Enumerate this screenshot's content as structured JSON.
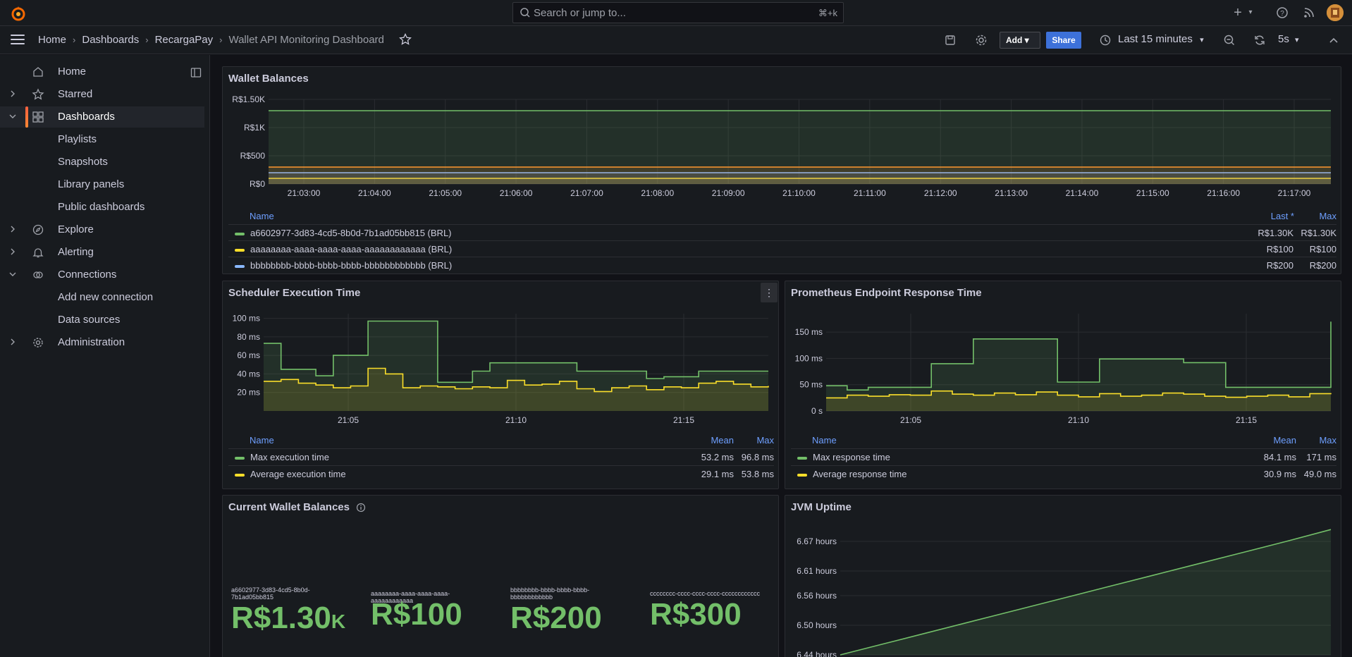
{
  "search": {
    "placeholder": "Search or jump to...",
    "shortcut": "⌘+k"
  },
  "breadcrumb": [
    "Home",
    "Dashboards",
    "RecargaPay",
    "Wallet API Monitoring Dashboard"
  ],
  "toolbar": {
    "add_label": "Add",
    "share_label": "Share",
    "time_range": "Last 15 minutes",
    "refresh_interval": "5s"
  },
  "sidebar": {
    "items": [
      {
        "label": "Home"
      },
      {
        "label": "Starred"
      },
      {
        "label": "Dashboards"
      },
      {
        "label": "Playlists"
      },
      {
        "label": "Snapshots"
      },
      {
        "label": "Library panels"
      },
      {
        "label": "Public dashboards"
      },
      {
        "label": "Explore"
      },
      {
        "label": "Alerting"
      },
      {
        "label": "Connections"
      },
      {
        "label": "Add new connection"
      },
      {
        "label": "Data sources"
      },
      {
        "label": "Administration"
      }
    ]
  },
  "colors": {
    "green": "#73bf69",
    "yellow": "#fade2a",
    "blue": "#8ab8ff",
    "orange": "#ff9830",
    "accent": "#3d71d9"
  },
  "panels": {
    "wallet_balances": {
      "title": "Wallet Balances",
      "legend_headers": {
        "name": "Name",
        "last": "Last *",
        "max": "Max"
      },
      "legend": [
        {
          "name": "a6602977-3d83-4cd5-8b0d-7b1ad05bb815 (BRL)",
          "last": "R$1.30K",
          "max": "R$1.30K",
          "color": "#73bf69"
        },
        {
          "name": "aaaaaaaa-aaaa-aaaa-aaaa-aaaaaaaaaaaa (BRL)",
          "last": "R$100",
          "max": "R$100",
          "color": "#fade2a"
        },
        {
          "name": "bbbbbbbb-bbbb-bbbb-bbbb-bbbbbbbbbbbb (BRL)",
          "last": "R$200",
          "max": "R$200",
          "color": "#8ab8ff"
        }
      ]
    },
    "scheduler": {
      "title": "Scheduler Execution Time",
      "legend_headers": {
        "name": "Name",
        "mean": "Mean",
        "max": "Max"
      },
      "legend": [
        {
          "name": "Max execution time",
          "mean": "53.2 ms",
          "max": "96.8 ms",
          "color": "#73bf69"
        },
        {
          "name": "Average execution time",
          "mean": "29.1 ms",
          "max": "53.8 ms",
          "color": "#fade2a"
        }
      ]
    },
    "prometheus": {
      "title": "Prometheus Endpoint Response Time",
      "legend_headers": {
        "name": "Name",
        "mean": "Mean",
        "max": "Max"
      },
      "legend": [
        {
          "name": "Max response time",
          "mean": "84.1 ms",
          "max": "171 ms",
          "color": "#73bf69"
        },
        {
          "name": "Average response time",
          "mean": "30.9 ms",
          "max": "49.0 ms",
          "color": "#fade2a"
        }
      ]
    },
    "current_balances": {
      "title": "Current Wallet Balances",
      "stats": [
        {
          "label": "a6602977-3d83-4cd5-8b0d-7b1ad05bb815",
          "value": "R$1.30",
          "unit": "K"
        },
        {
          "label": "aaaaaaaa-aaaa-aaaa-aaaa-aaaaaaaaaaaa",
          "value": "R$100",
          "unit": ""
        },
        {
          "label": "bbbbbbbb-bbbb-bbbb-bbbb-bbbbbbbbbbbb",
          "value": "R$200",
          "unit": ""
        },
        {
          "label": "cccccccc-cccc-cccc-cccc-cccccccccccc",
          "value": "R$300",
          "unit": ""
        }
      ]
    },
    "jvm_uptime": {
      "title": "JVM Uptime"
    }
  },
  "chart_data": [
    {
      "type": "line",
      "title": "Wallet Balances",
      "x": [
        "21:03:00",
        "21:04:00",
        "21:05:00",
        "21:06:00",
        "21:07:00",
        "21:08:00",
        "21:09:00",
        "21:10:00",
        "21:11:00",
        "21:12:00",
        "21:13:00",
        "21:14:00",
        "21:15:00",
        "21:16:00",
        "21:17:00"
      ],
      "y_ticks": [
        "R$0",
        "R$500",
        "R$1K",
        "R$1.50K"
      ],
      "ylim": [
        0,
        1500
      ],
      "series": [
        {
          "name": "a6602977-3d83-4cd5-8b0d-7b1ad05bb815 (BRL)",
          "values": [
            1300,
            1300,
            1300,
            1300,
            1300,
            1300,
            1300,
            1300,
            1300,
            1300,
            1300,
            1300,
            1300,
            1300,
            1300
          ]
        },
        {
          "name": "aaaaaaaa-aaaa-aaaa-aaaa-aaaaaaaaaaaa (BRL)",
          "values": [
            100,
            100,
            100,
            100,
            100,
            100,
            100,
            100,
            100,
            100,
            100,
            100,
            100,
            100,
            100
          ]
        },
        {
          "name": "bbbbbbbb-bbbb-bbbb-bbbb-bbbbbbbbbbbb (BRL)",
          "values": [
            200,
            200,
            200,
            200,
            200,
            200,
            200,
            200,
            200,
            200,
            200,
            200,
            200,
            200,
            200
          ]
        },
        {
          "values": [
            300,
            300,
            300,
            300,
            300,
            300,
            300,
            300,
            300,
            300,
            300,
            300,
            300,
            300,
            300
          ]
        }
      ]
    },
    {
      "type": "area",
      "title": "Scheduler Execution Time",
      "x_ticks": [
        "21:05",
        "21:10",
        "21:15"
      ],
      "y_ticks": [
        "20 ms",
        "40 ms",
        "60 ms",
        "80 ms",
        "100 ms"
      ],
      "ylim": [
        0,
        105
      ],
      "series": [
        {
          "name": "Max execution time",
          "values": [
            73,
            45,
            45,
            38,
            60,
            60,
            97,
            97,
            97,
            97,
            31,
            31,
            43,
            52,
            52,
            52,
            52,
            52,
            43,
            43,
            43,
            43,
            35,
            37,
            37,
            43,
            43,
            43,
            43,
            43
          ]
        },
        {
          "name": "Average execution time",
          "values": [
            32,
            34,
            30,
            28,
            25,
            27,
            46,
            40,
            25,
            27,
            26,
            24,
            26,
            25,
            33,
            28,
            29,
            32,
            24,
            21,
            25,
            27,
            23,
            26,
            25,
            30,
            32,
            29,
            26,
            27
          ]
        }
      ]
    },
    {
      "type": "area",
      "title": "Prometheus Endpoint Response Time",
      "x_ticks": [
        "21:05",
        "21:10",
        "21:15"
      ],
      "y_ticks": [
        "0 s",
        "50 ms",
        "100 ms",
        "150 ms"
      ],
      "ylim": [
        0,
        185
      ],
      "series": [
        {
          "name": "Max response time",
          "values": [
            48,
            40,
            45,
            45,
            45,
            90,
            90,
            137,
            137,
            137,
            137,
            55,
            55,
            99,
            99,
            99,
            99,
            92,
            92,
            45,
            45,
            45,
            45,
            45,
            170
          ]
        },
        {
          "name": "Average response time",
          "values": [
            25,
            30,
            28,
            31,
            30,
            38,
            32,
            30,
            34,
            31,
            36,
            30,
            27,
            33,
            28,
            30,
            34,
            32,
            28,
            26,
            28,
            30,
            27,
            33,
            34
          ]
        }
      ]
    },
    {
      "type": "line",
      "title": "JVM Uptime",
      "y_ticks": [
        "6.44 hours",
        "6.50 hours",
        "6.56 hours",
        "6.61 hours",
        "6.67 hours"
      ],
      "ylim": [
        6.44,
        6.7
      ],
      "series": [
        {
          "values": [
            6.44,
            6.463,
            6.486,
            6.509,
            6.532,
            6.555,
            6.578,
            6.601,
            6.624,
            6.647,
            6.67,
            6.694
          ]
        }
      ]
    }
  ]
}
